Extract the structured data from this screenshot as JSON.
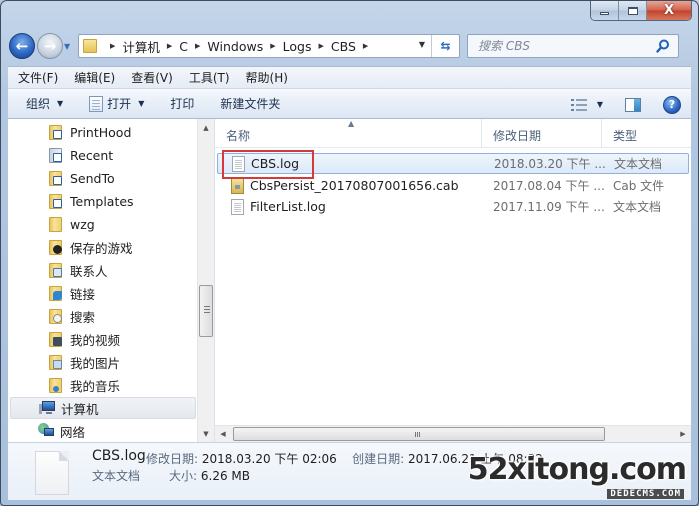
{
  "window": {
    "minimize_label": "minimize",
    "maximize_label": "maximize",
    "close_glyph": "X"
  },
  "navigation": {
    "back_glyph": "←",
    "forward_glyph": "→",
    "breadcrumb": [
      "计算机",
      "C",
      "Windows",
      "Logs",
      "CBS"
    ],
    "search_placeholder": "搜索 CBS"
  },
  "menu": {
    "items": [
      "文件(F)",
      "编辑(E)",
      "查看(V)",
      "工具(T)",
      "帮助(H)"
    ]
  },
  "toolbar": {
    "organize": "组织",
    "open": "打开",
    "print": "打印",
    "new_folder": "新建文件夹",
    "help_glyph": "?"
  },
  "nav_pane": {
    "items": [
      {
        "label": "PrintHood",
        "icon": "shortcut-folder-icon"
      },
      {
        "label": "Recent",
        "icon": "recent-folder-icon"
      },
      {
        "label": "SendTo",
        "icon": "shortcut-folder-icon"
      },
      {
        "label": "Templates",
        "icon": "shortcut-folder-icon"
      },
      {
        "label": "wzg",
        "icon": "folder-icon"
      },
      {
        "label": "保存的游戏",
        "icon": "saved-games-icon"
      },
      {
        "label": "联系人",
        "icon": "contacts-icon"
      },
      {
        "label": "链接",
        "icon": "links-icon"
      },
      {
        "label": "搜索",
        "icon": "searches-icon"
      },
      {
        "label": "我的视频",
        "icon": "videos-icon"
      },
      {
        "label": "我的图片",
        "icon": "pictures-icon"
      },
      {
        "label": "我的音乐",
        "icon": "music-icon"
      }
    ],
    "computer": "计算机",
    "network": "网络"
  },
  "file_list": {
    "columns": {
      "name": "名称",
      "date": "修改日期",
      "type": "类型"
    },
    "rows": [
      {
        "name": "CBS.log",
        "date": "2018.03.20 下午 ...",
        "type": "文本文档",
        "selected": true,
        "icon": "text-file-icon"
      },
      {
        "name": "CbsPersist_20170807001656.cab",
        "date": "2017.08.04 下午 ...",
        "type": "Cab 文件",
        "selected": false,
        "icon": "cab-file-icon"
      },
      {
        "name": "FilterList.log",
        "date": "2017.11.09 下午 ...",
        "type": "文本文档",
        "selected": false,
        "icon": "text-file-icon"
      }
    ]
  },
  "details": {
    "name": "CBS.log",
    "modified_label": "修改日期:",
    "modified": "2018.03.20 下午 02:06",
    "created_label": "创建日期:",
    "created": "2017.06.21 上午 08:32",
    "type": "文本文档",
    "size_label": "大小:",
    "size": "6.26 MB"
  },
  "watermark": {
    "main": "52xitong.com",
    "sub": "DEDECMS.COM"
  },
  "colors": {
    "highlight_box": "#d43a3a",
    "selection": "#dce9f9",
    "title_glass": "#b2c7e0"
  }
}
